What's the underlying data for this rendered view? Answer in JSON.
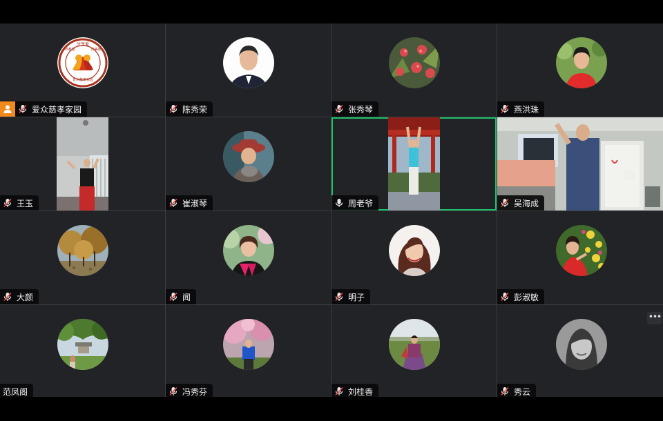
{
  "meeting": {
    "participants": [
      {
        "id": "p1",
        "name": "爱众慈孝家园",
        "mic": "muted",
        "host": true,
        "tile": "avatar",
        "pic": "logo",
        "logo_text": [
          "尽孝道",
          "分享爱",
          "传美德"
        ],
        "logo_bottom": "爱众慈孝家园"
      },
      {
        "id": "p2",
        "name": "陈秀荣",
        "mic": "muted",
        "tile": "avatar",
        "pic": "man-suit"
      },
      {
        "id": "p3",
        "name": "张秀琴",
        "mic": "muted",
        "tile": "avatar",
        "pic": "flowers-red"
      },
      {
        "id": "p4",
        "name": "燕洪珠",
        "mic": "muted",
        "tile": "avatar",
        "pic": "woman-red"
      },
      {
        "id": "p5",
        "name": "王玉",
        "mic": "muted",
        "tile": "video",
        "pic": "room-exercise"
      },
      {
        "id": "p6",
        "name": "崔淑琴",
        "mic": "muted",
        "tile": "avatar",
        "pic": "woman-hat"
      },
      {
        "id": "p7",
        "name": "周老爷",
        "mic": "unmuted",
        "tile": "video",
        "active": true,
        "pic": "pavilion"
      },
      {
        "id": "p8",
        "name": "吴海成",
        "mic": "muted",
        "tile": "video",
        "pic": "man-room"
      },
      {
        "id": "p9",
        "name": "大颜",
        "mic": "muted",
        "tile": "avatar",
        "pic": "autumn-park"
      },
      {
        "id": "p10",
        "name": "闻",
        "mic": "muted",
        "tile": "avatar",
        "pic": "woman-scarf"
      },
      {
        "id": "p11",
        "name": "明子",
        "mic": "muted",
        "tile": "avatar",
        "pic": "woman-hair"
      },
      {
        "id": "p12",
        "name": "彭淑敏",
        "mic": "muted",
        "tile": "avatar",
        "pic": "woman-flowers"
      },
      {
        "id": "p13",
        "name": "范凤阁",
        "mic": "none",
        "tile": "avatar",
        "pic": "garden"
      },
      {
        "id": "p14",
        "name": "冯秀芬",
        "mic": "muted",
        "tile": "avatar",
        "pic": "blossom"
      },
      {
        "id": "p15",
        "name": "刘桂香",
        "mic": "muted",
        "tile": "avatar",
        "pic": "field"
      },
      {
        "id": "p16",
        "name": "秀云",
        "mic": "muted",
        "tile": "avatar",
        "pic": "woman-bw",
        "more_menu": "•••"
      }
    ]
  },
  "colors": {
    "tile_bg": "#222326",
    "grid_line": "#3c3e42",
    "active_border": "#1ec06a",
    "host_badge": "#f08a1d",
    "mute_red": "#e8453c"
  },
  "icons": {
    "muted": "mic-muted-icon",
    "unmuted": "mic-icon",
    "host": "host-user-icon",
    "more": "more-options-icon"
  }
}
